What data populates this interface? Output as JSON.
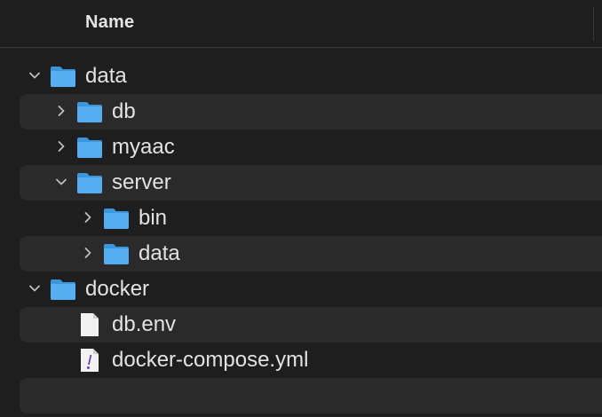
{
  "header": {
    "column_name": "Name"
  },
  "tree": [
    {
      "label": "data",
      "type": "folder",
      "expanded": true,
      "depth": 0
    },
    {
      "label": "db",
      "type": "folder",
      "expanded": false,
      "depth": 1
    },
    {
      "label": "myaac",
      "type": "folder",
      "expanded": false,
      "depth": 1
    },
    {
      "label": "server",
      "type": "folder",
      "expanded": true,
      "depth": 1
    },
    {
      "label": "bin",
      "type": "folder",
      "expanded": false,
      "depth": 2
    },
    {
      "label": "data",
      "type": "folder",
      "expanded": false,
      "depth": 2
    },
    {
      "label": "docker",
      "type": "folder",
      "expanded": true,
      "depth": 0
    },
    {
      "label": "db.env",
      "type": "file",
      "depth": 1
    },
    {
      "label": "docker-compose.yml",
      "type": "yaml-file",
      "depth": 1
    }
  ],
  "colors": {
    "background": "#1e1e1e",
    "alt_row": "#2a2a2a",
    "folder": "#4fa9ec",
    "text": "#e2e2e2"
  },
  "icons": {
    "folder": "folder-icon",
    "file": "document-icon",
    "yaml": "yaml-file-icon",
    "expanded": "chevron-down-icon",
    "collapsed": "chevron-right-icon"
  }
}
